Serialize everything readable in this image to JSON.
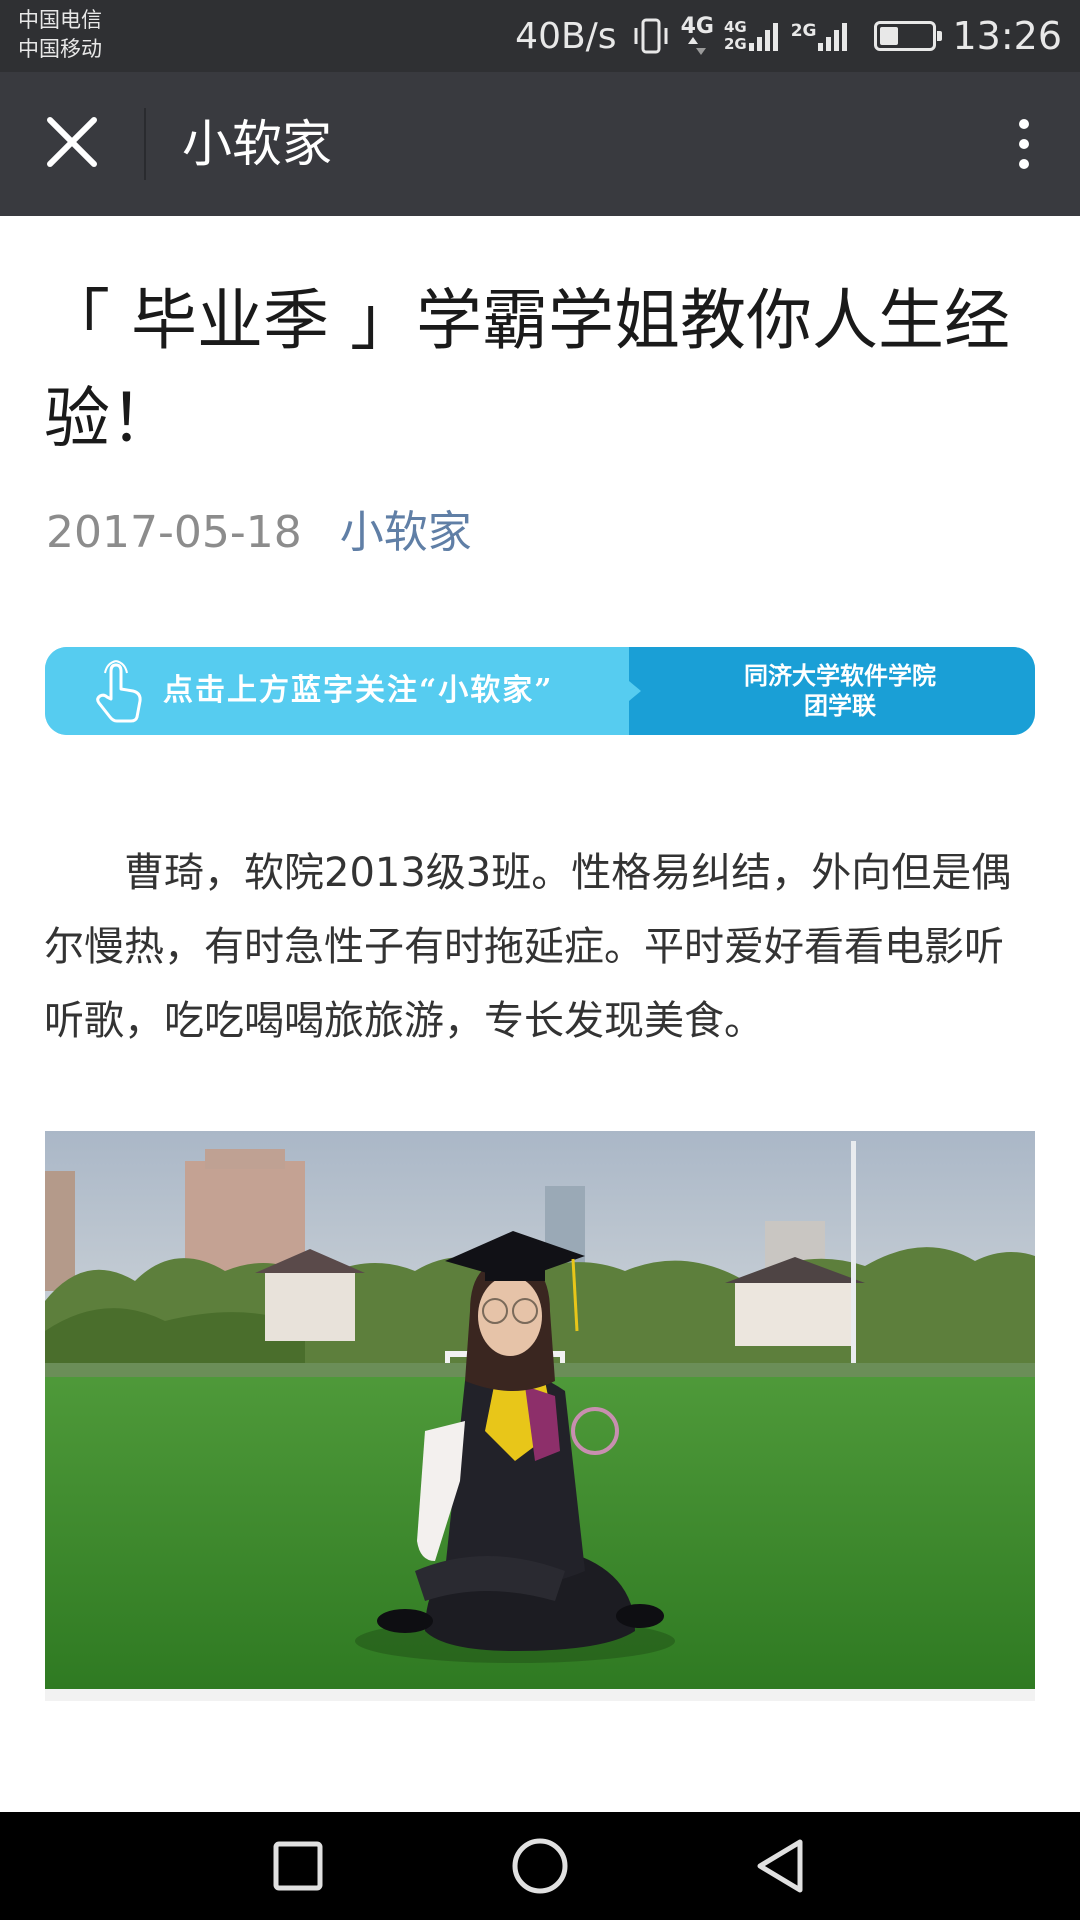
{
  "status_bar": {
    "carrier_1": "中国电信",
    "carrier_2": "中国移动",
    "network_speed": "40B/s",
    "network_1": "4G",
    "network_2_top": "4G",
    "network_2_bottom": "2G",
    "network_3": "2G",
    "battery_level": 0.35,
    "time": "13:26"
  },
  "title_bar": {
    "title": "小软家",
    "close_icon": "close-icon",
    "more_icon": "more-vertical-icon"
  },
  "article": {
    "title": "「 毕业季 」学霸学姐教你人生经验！",
    "date": "2017-05-18",
    "author": "小软家",
    "banner": {
      "prompt": "点击上方蓝字关注“小软家”",
      "org_line_1": "同济大学软件学院",
      "org_line_2": "团学联",
      "icon": "hand-tap-icon"
    },
    "paragraph": "曹琦，软院2013级3班。性格易纠结，外向但是偶尔慢热，有时急性子有时拖延症。平时爱好看看电影听听歌，吃吃喝喝旅旅游，专长发现美食。",
    "photo": "graduate-photo"
  },
  "nav_bar": {
    "recent_icon": "square-icon",
    "home_icon": "circle-icon",
    "back_icon": "triangle-back-icon"
  },
  "colors": {
    "status_bar_bg": "#2f3033",
    "title_bar_bg": "#393a3f",
    "author_link": "#607fa6",
    "banner_light": "#56ccf0",
    "banner_dark": "#1a9fd6"
  }
}
